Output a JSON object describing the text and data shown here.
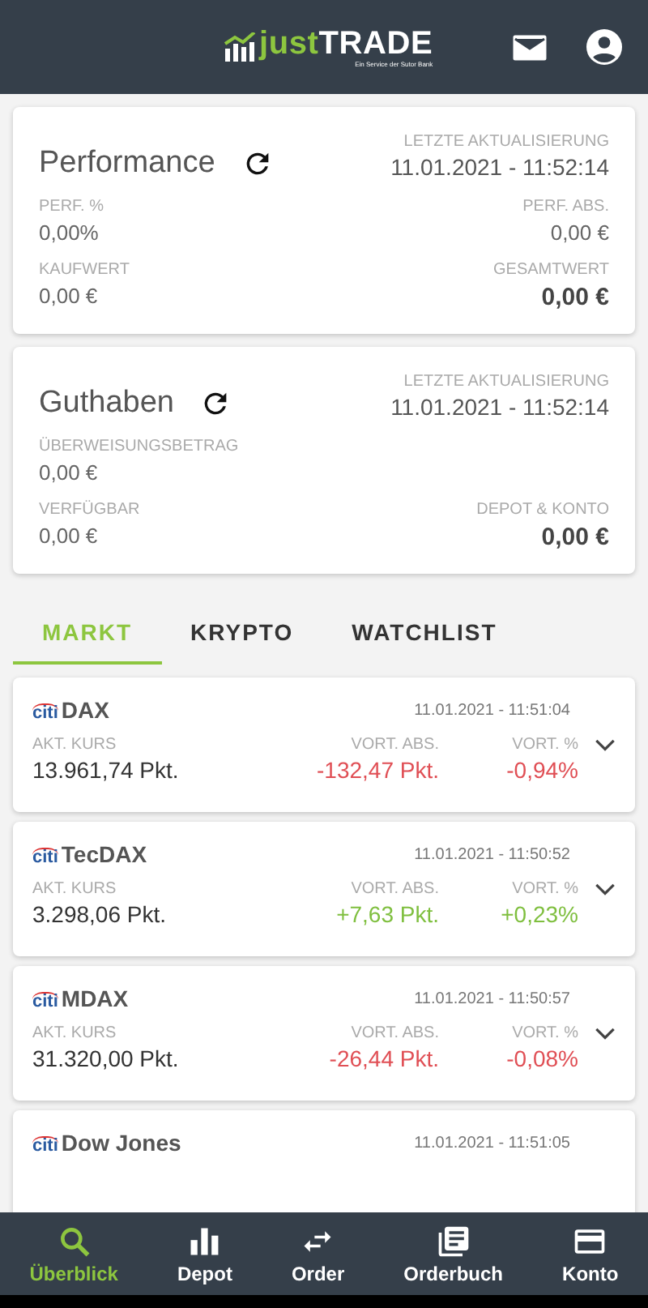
{
  "header": {
    "logo": {
      "brand_light": "just",
      "brand_bold": "TRADE",
      "tagline": "Ein Service der Sutor Bank"
    }
  },
  "summary_cards": [
    {
      "title": "Performance",
      "updated_label": "LETZTE AKTUALISIERUNG",
      "updated": "11.01.2021 - 11:52:14",
      "fields": [
        {
          "label": "PERF. %",
          "value": "0,00%",
          "kind": "left",
          "bold": false
        },
        {
          "label": "PERF. ABS.",
          "value": "0,00 €",
          "kind": "right",
          "bold": false
        },
        {
          "label": "KAUFWERT",
          "value": "0,00 €",
          "kind": "left",
          "bold": false
        },
        {
          "label": "GESAMTWERT",
          "value": "0,00 €",
          "kind": "right",
          "bold": true
        }
      ]
    },
    {
      "title": "Guthaben",
      "updated_label": "LETZTE AKTUALISIERUNG",
      "updated": "11.01.2021 - 11:52:14",
      "fields": [
        {
          "label": "ÜBERWEISUNGSBETRAG",
          "value": "0,00 €",
          "kind": "left",
          "bold": false
        },
        {
          "label": "VERFÜGBAR",
          "value": "0,00 €",
          "kind": "left",
          "bold": false
        },
        {
          "label": "DEPOT & KONTO",
          "value": "0,00 €",
          "kind": "right",
          "bold": true
        }
      ]
    }
  ],
  "tabs": [
    {
      "label": "MARKT",
      "selected": true
    },
    {
      "label": "KRYPTO",
      "selected": false
    },
    {
      "label": "WATCHLIST",
      "selected": false
    }
  ],
  "markets": [
    {
      "issuer": "citi",
      "name": "DAX",
      "time": "11.01.2021 - 11:51:04",
      "kurs_label": "AKT. KURS",
      "kurs": "13.961,74 Pkt.",
      "abs_label": "VORT. ABS.",
      "abs": "-132,47 Pkt.",
      "pct_label": "VORT. %",
      "pct": "-0,94%",
      "color": "#e04f55"
    },
    {
      "issuer": "citi",
      "name": "TecDAX",
      "time": "11.01.2021 - 11:50:52",
      "kurs_label": "AKT. KURS",
      "kurs": "3.298,06 Pkt.",
      "abs_label": "VORT. ABS.",
      "abs": "+7,63 Pkt.",
      "pct_label": "VORT. %",
      "pct": "+0,23%",
      "color": "#7fbf3f"
    },
    {
      "issuer": "citi",
      "name": "MDAX",
      "time": "11.01.2021 - 11:50:57",
      "kurs_label": "AKT. KURS",
      "kurs": "31.320,00 Pkt.",
      "abs_label": "VORT. ABS.",
      "abs": "-26,44 Pkt.",
      "pct_label": "VORT. %",
      "pct": "-0,08%",
      "color": "#e04f55"
    },
    {
      "issuer": "citi",
      "name": "Dow Jones",
      "time": "11.01.2021 - 11:51:05"
    }
  ],
  "bottom_nav": [
    {
      "label": "Überblick",
      "kind": "search",
      "selected": true
    },
    {
      "label": "Depot",
      "kind": "bars",
      "selected": false
    },
    {
      "label": "Order",
      "kind": "swap",
      "selected": false
    },
    {
      "label": "Orderbuch",
      "kind": "book",
      "selected": false
    },
    {
      "label": "Konto",
      "kind": "card",
      "selected": false
    }
  ]
}
